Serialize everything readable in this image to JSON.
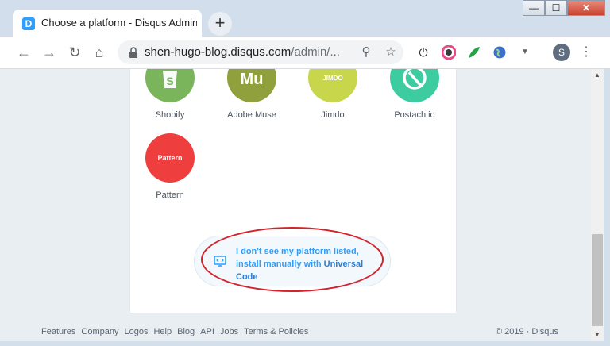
{
  "tab": {
    "title": "Choose a platform - Disqus Admin",
    "favicon_letter": "D"
  },
  "window_controls": {
    "minimize": "—",
    "maximize": "☐",
    "close": "✕"
  },
  "toolbar": {
    "url_host": "shen-hugo-blog.disqus.com",
    "url_path": "/admin/...",
    "avatar_letter": "S"
  },
  "platforms": [
    {
      "name": "Shopify",
      "logo_text": "S",
      "color": "#7ab55c"
    },
    {
      "name": "Adobe Muse",
      "logo_text": "Mu",
      "color": "#8fa03c"
    },
    {
      "name": "Jimdo",
      "logo_text": "JIMDO",
      "color": "#c7d64a"
    },
    {
      "name": "Postach.io",
      "logo_text": "",
      "color": "#3dcba0"
    },
    {
      "name": "Pattern",
      "logo_text": "Pattern",
      "color": "#ee3e3e"
    }
  ],
  "universal": {
    "line1": "I don't see my platform listed,",
    "line2_prefix": "install manually with ",
    "line2_strong": "Universal",
    "line3": "Code"
  },
  "footer": {
    "links": [
      "Features",
      "Company",
      "Logos",
      "Help",
      "Blog",
      "API",
      "Jobs",
      "Terms & Policies"
    ],
    "copyright": "© 2019 · Disqus"
  },
  "colors": {
    "accent": "#2e9fff",
    "annotation": "#d4232b"
  }
}
